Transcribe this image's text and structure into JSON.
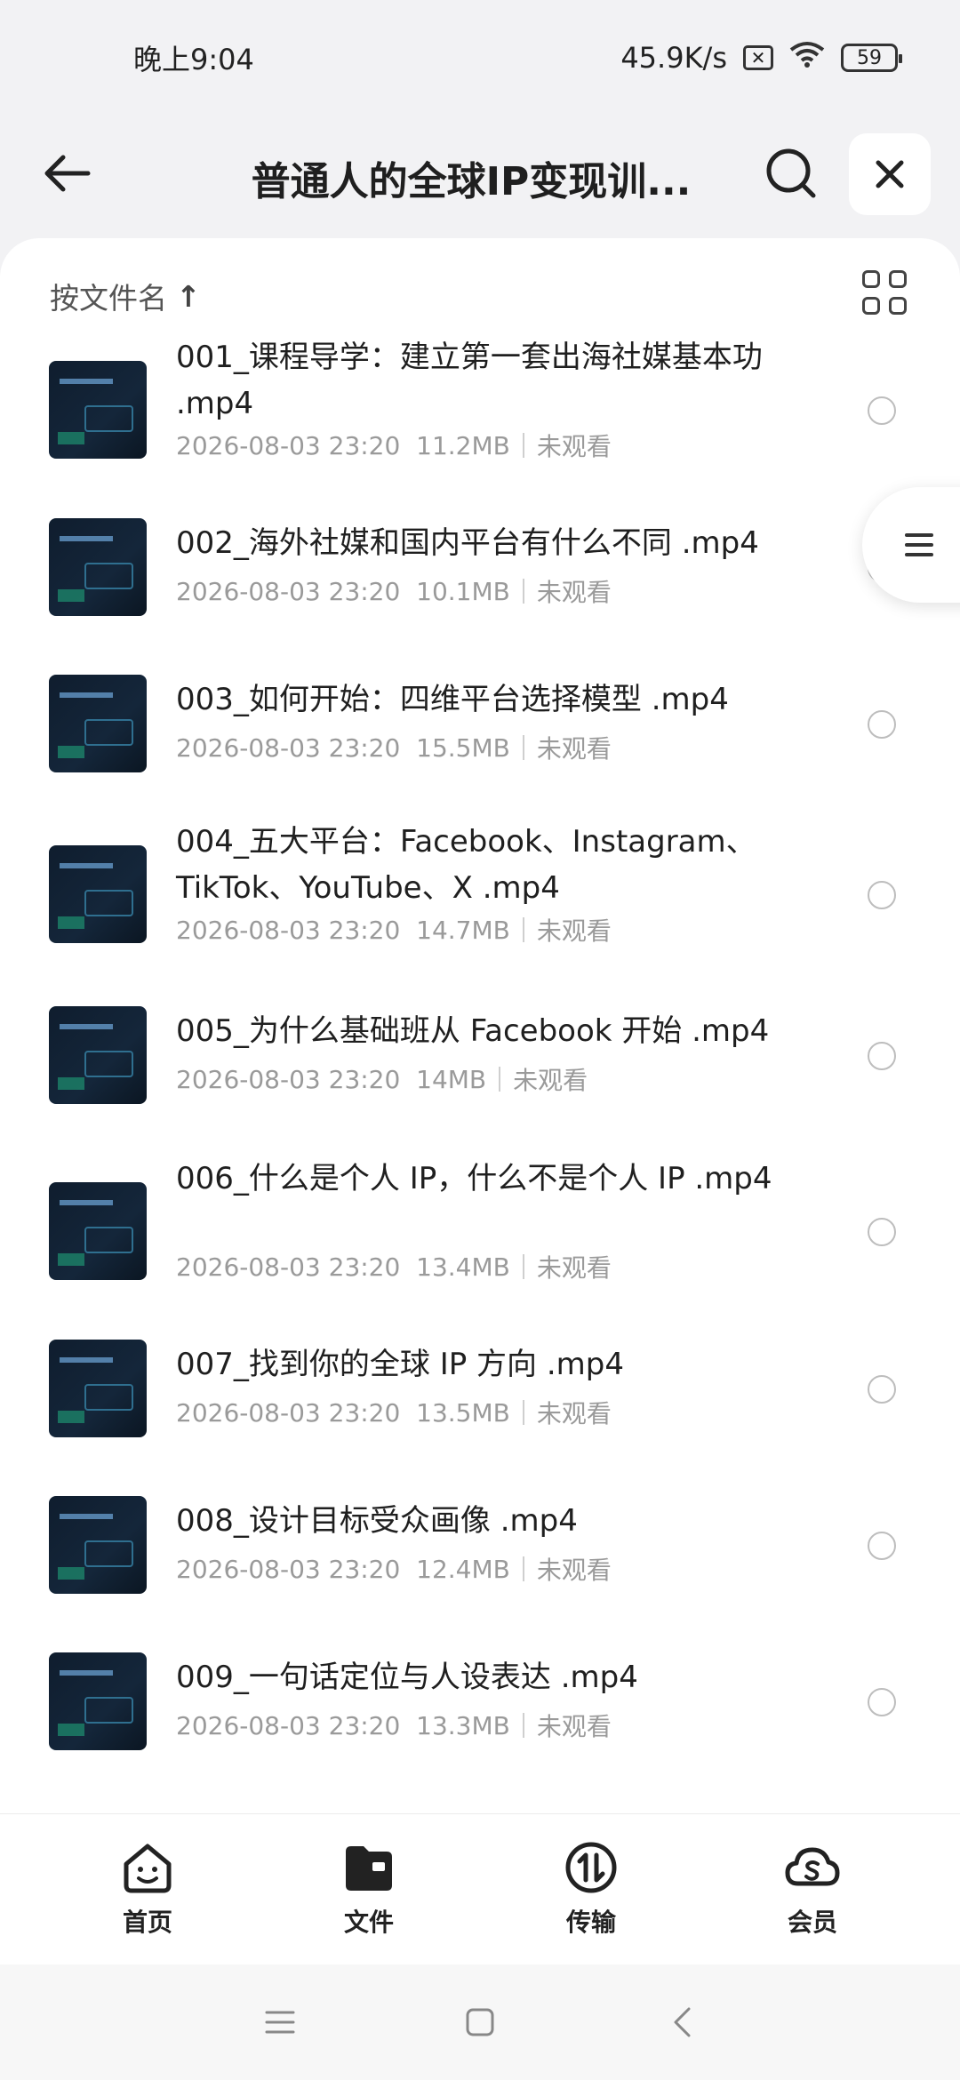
{
  "status_bar": {
    "time": "晚上9:04",
    "network_speed": "45.9K/s",
    "sim_icon": "x-box-icon",
    "battery": "59"
  },
  "top_nav": {
    "title": "普通人的全球IP变现训...",
    "back_icon": "arrow-left-icon",
    "search_icon": "search-icon",
    "close_icon": "close-icon"
  },
  "sort_bar": {
    "label": "按文件名",
    "arrow": "↑"
  },
  "files": [
    {
      "name": "001_课程导学：建立第一套出海社媒基本功 .mp4",
      "date": "2026-08-03 23:20",
      "size": "11.2MB",
      "status": "未观看"
    },
    {
      "name": "002_海外社媒和国内平台有什么不同 .mp4",
      "date": "2026-08-03 23:20",
      "size": "10.1MB",
      "status": "未观看"
    },
    {
      "name": "003_如何开始：四维平台选择模型 .mp4",
      "date": "2026-08-03 23:20",
      "size": "15.5MB",
      "status": "未观看"
    },
    {
      "name": "004_五大平台：Facebook、Instagram、TikTok、YouTube、X .mp4",
      "date": "2026-08-03 23:20",
      "size": "14.7MB",
      "status": "未观看"
    },
    {
      "name": "005_为什么基础班从 Facebook 开始 .mp4",
      "date": "2026-08-03 23:20",
      "size": "14MB",
      "status": "未观看"
    },
    {
      "name": "006_什么是个人 IP，什么不是个人 IP .mp4",
      "date": "2026-08-03 23:20",
      "size": "13.4MB",
      "status": "未观看"
    },
    {
      "name": "007_找到你的全球 IP 方向 .mp4",
      "date": "2026-08-03 23:20",
      "size": "13.5MB",
      "status": "未观看"
    },
    {
      "name": "008_设计目标受众画像 .mp4",
      "date": "2026-08-03 23:20",
      "size": "12.4MB",
      "status": "未观看"
    },
    {
      "name": "009_一句话定位与人设表达 .mp4",
      "date": "2026-08-03 23:20",
      "size": "13.3MB",
      "status": "未观看"
    }
  ],
  "tabs": [
    {
      "label": "首页",
      "icon": "home-smile-icon"
    },
    {
      "label": "文件",
      "icon": "folder-icon"
    },
    {
      "label": "传输",
      "icon": "transfer-icon"
    },
    {
      "label": "会员",
      "icon": "vip-cloud-icon"
    }
  ]
}
